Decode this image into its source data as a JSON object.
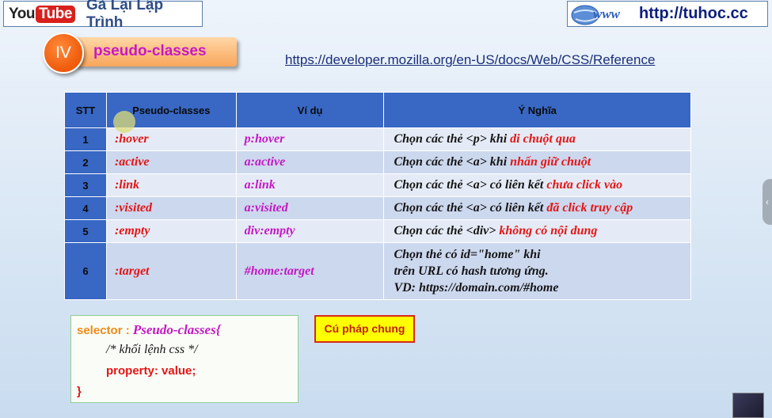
{
  "header": {
    "youtube_you": "You",
    "youtube_tube": "Tube",
    "channel_name": "Gà Lại Lập Trình",
    "site_url": "http://tuhoc.cc",
    "globe_text": "www"
  },
  "section": {
    "number": "IV",
    "title": "pseudo-classes"
  },
  "reference_link": "https://developer.mozilla.org/en-US/docs/Web/CSS/Reference",
  "table": {
    "headers": [
      "STT",
      "Pseudo-classes",
      "Ví dụ",
      "Ý Nghĩa"
    ],
    "rows": [
      {
        "stt": "1",
        "pseudo": ":hover",
        "example": "p:hover",
        "meaning_pre": "Chọn các thẻ <p> khi ",
        "meaning_hl": "di chuột qua"
      },
      {
        "stt": "2",
        "pseudo": ":active",
        "example": "a:active",
        "meaning_pre": "Chọn các thẻ <a> khi ",
        "meaning_hl": "nhấn giữ chuột"
      },
      {
        "stt": "3",
        "pseudo": ":link",
        "example": "a:link",
        "meaning_pre": "Chọn các thẻ <a> có liên kết ",
        "meaning_hl": "chưa click vào"
      },
      {
        "stt": "4",
        "pseudo": ":visited",
        "example": "a:visited",
        "meaning_pre": "Chọn các thẻ <a> có liên kết ",
        "meaning_hl": "đã click truy cập"
      },
      {
        "stt": "5",
        "pseudo": ":empty",
        "example": "div:empty",
        "meaning_pre": "Chọn các thẻ <div> ",
        "meaning_hl": "không có nội dung"
      },
      {
        "stt": "6",
        "pseudo": ":target",
        "example": "#home:target",
        "meaning_lines": [
          "Chọn thẻ có id=\"home\" khi",
          "trên URL có hash tương ứng.",
          "VD: https://domain.com/#home"
        ]
      }
    ]
  },
  "syntax": {
    "selector": "selector : ",
    "pseudo": "Pseudo-classes{",
    "comment": "/* khối lệnh css */",
    "property": "property: value;",
    "close": "}"
  },
  "syntax_label": "Cú pháp chung",
  "colors": {
    "accent_red": "#e41515",
    "accent_magenta": "#c418c4",
    "table_header_blue": "#3867c4",
    "banner_orange": "#f8a65b"
  }
}
